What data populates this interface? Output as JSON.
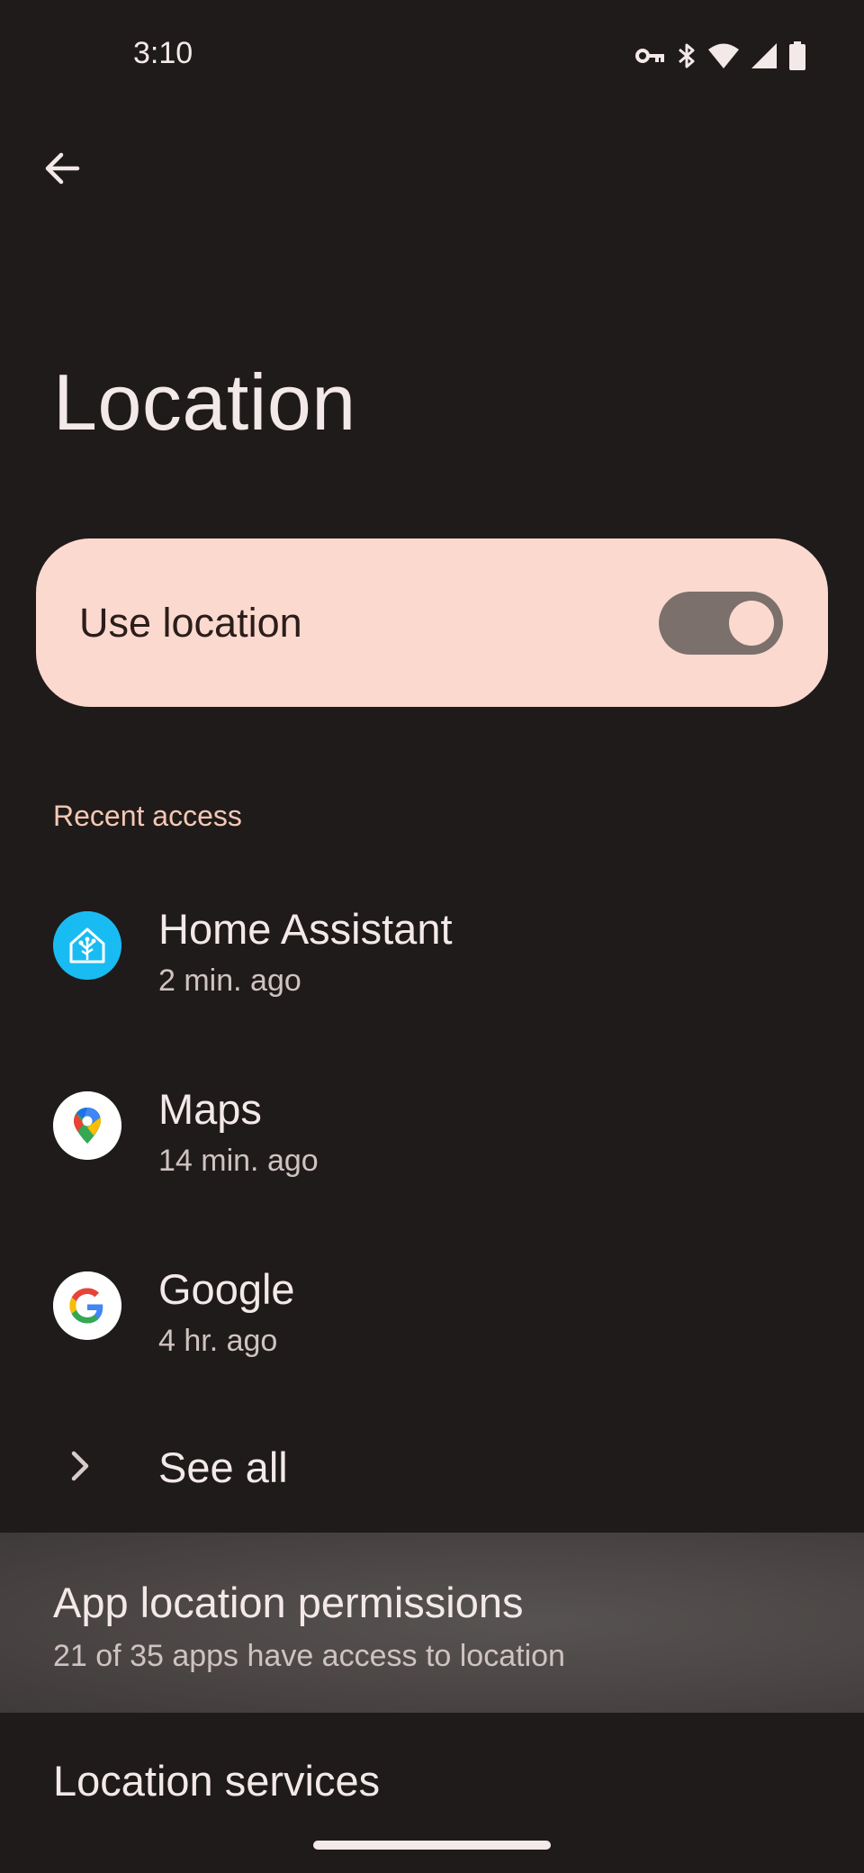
{
  "status_bar": {
    "time": "3:10",
    "icons": [
      "vpn-key-icon",
      "bluetooth-icon",
      "wifi-icon",
      "signal-icon",
      "battery-icon"
    ]
  },
  "header": {
    "back_icon": "arrow-back-icon",
    "title": "Location"
  },
  "use_location": {
    "label": "Use location",
    "enabled": true
  },
  "recent_access": {
    "header": "Recent access",
    "apps": [
      {
        "name": "Home Assistant",
        "time": "2 min. ago",
        "icon": "home-assistant-icon"
      },
      {
        "name": "Maps",
        "time": "14 min. ago",
        "icon": "google-maps-icon"
      },
      {
        "name": "Google",
        "time": "4 hr. ago",
        "icon": "google-icon"
      }
    ],
    "see_all_label": "See all"
  },
  "app_permissions": {
    "title": "App location permissions",
    "subtitle": "21 of 35 apps have access to location"
  },
  "location_services": {
    "title": "Location services"
  },
  "colors": {
    "background": "#1f1b1b",
    "card": "#fcd9cf",
    "accent_text": "#f5c8b4",
    "toggle_track": "#7b706c"
  }
}
